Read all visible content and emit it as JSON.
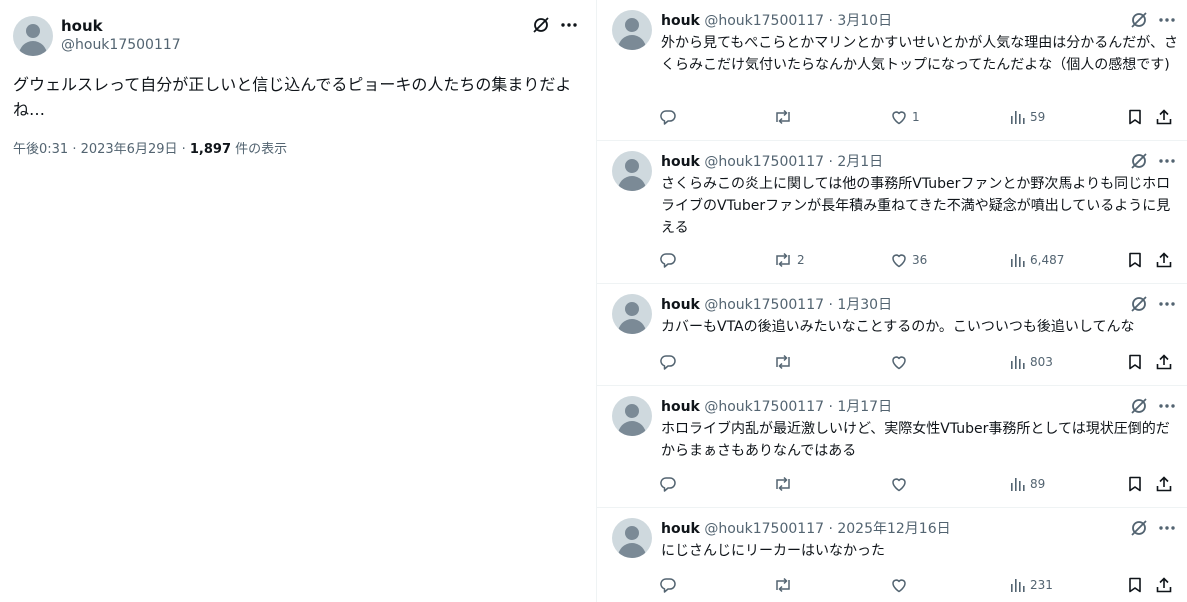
{
  "main_tweet": {
    "author_name": "houk",
    "handle": "@houk17500117",
    "text": "グウェルスレって自分が正しいと信じ込んでるピョーキの人たちの集まりだよね…",
    "timestamp": "午後0:31 · 2023年6月29日 · ",
    "views": "1,897",
    "views_label": " 件の表示"
  },
  "replies": [
    {
      "name": "houk",
      "meta": "@houk17500117 · 3月10日",
      "text": "外から見てもぺこらとかマリンとかすいせいとかが人気な理由は分かるんだが、さくらみこだけ気付いたらなんか人気トップになってたんだよな（個人の感想です)",
      "replies": "",
      "retweets": "",
      "likes": "1",
      "views": "59"
    },
    {
      "name": "houk",
      "meta": "@houk17500117 · 2月1日",
      "text": "さくらみこの炎上に関しては他の事務所VTuberファンとか野次馬よりも同じホロライブのVTuberファンが長年積み重ねてきた不満や疑念が噴出しているように見える",
      "replies": "",
      "retweets": "2",
      "likes": "36",
      "views": "6,487"
    },
    {
      "name": "houk",
      "meta": "@houk17500117 · 1月30日",
      "text": "カバーもVTAの後追いみたいなことするのか。こいついつも後追いしてんな",
      "replies": "",
      "retweets": "",
      "likes": "",
      "views": "803"
    },
    {
      "name": "houk",
      "meta": "@houk17500117 · 1月17日",
      "text": "ホロライブ内乱が最近激しいけど、実際女性VTuber事務所としては現状圧倒的だからまぁさもありなんではある",
      "replies": "",
      "retweets": "",
      "likes": "",
      "views": "89"
    },
    {
      "name": "houk",
      "meta": "@houk17500117 · 2025年12月16日",
      "text": "にじさんじにリーカーはいなかった",
      "replies": "",
      "retweets": "",
      "likes": "",
      "views": "231"
    }
  ]
}
